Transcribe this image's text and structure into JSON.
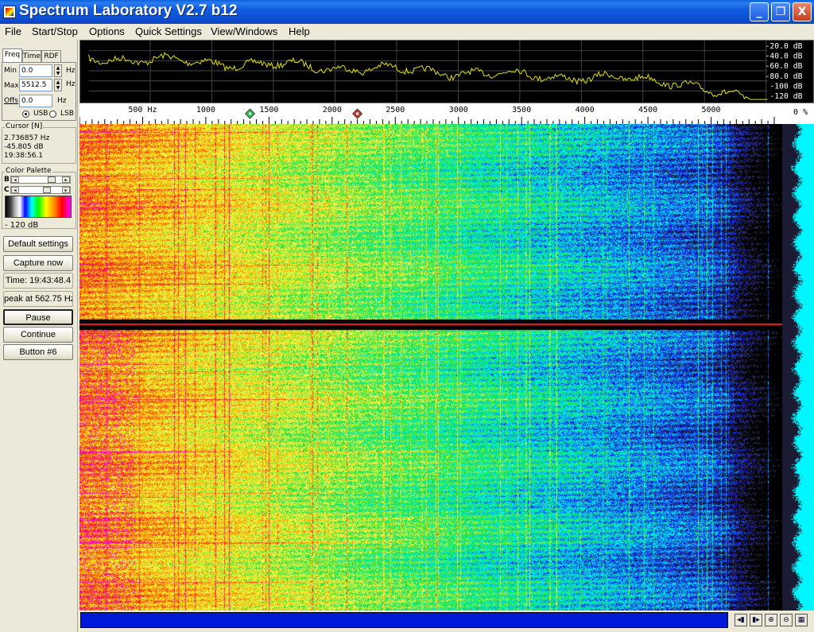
{
  "window": {
    "title": "Spectrum Laboratory V2.7 b12",
    "buttons": {
      "minimize": "_",
      "maximize": "❐",
      "close": "X"
    }
  },
  "menu": [
    "File",
    "Start/Stop",
    "Options",
    "Quick Settings",
    "View/Windows",
    "Help"
  ],
  "panel": {
    "tabs": [
      "Freq",
      "Time",
      "RDF"
    ],
    "min_label": "Min",
    "min_value": "0.0",
    "max_label": "Max",
    "max_value": "5512.5",
    "offs_label": "Offs",
    "offs_value": "0.0",
    "unit_hz": "Hz",
    "usb_label": "USB",
    "lsb_label": "LSB",
    "usb_selected": true,
    "cursor_title": "Cursor [N]",
    "cursor_freq": "2.736857 Hz",
    "cursor_level": "-45.805 dB",
    "cursor_time": "19:38:56.1",
    "palette_title": "Color Palette",
    "palette_b": "B",
    "palette_c": "C",
    "palette_db": "- 120 dB",
    "buttons": {
      "default_settings": "Default settings",
      "capture_now": "Capture now",
      "time": "Time:  19:43:48.4",
      "peak": "peak at 562.75 Hz",
      "pause": "Pause",
      "continue": "Continue",
      "button6": "Button #6"
    }
  },
  "spectrum": {
    "db_labels": [
      "-20.0 dB",
      "-40.0 dB",
      "-60.0 dB",
      "-80.0 dB",
      "-100 dB",
      "-120 dB"
    ],
    "freq_labels": [
      "500 Hz",
      "1000",
      "1500",
      "2000",
      "2500",
      "3000",
      "3500",
      "4000",
      "4500",
      "5000"
    ],
    "percent_label": "0 %",
    "marker1_hz": 1350,
    "marker2_hz": 2200,
    "max_hz": 5512.5,
    "trace_color": "#e6e600",
    "marker1_color": "#2db84d",
    "marker2_color": "#c0392b"
  },
  "status": {
    "progress_color": "#0018d8",
    "icons": [
      "prev-icon",
      "next-icon",
      "zoom-in-icon",
      "zoom-out-icon",
      "scale-icon"
    ]
  }
}
